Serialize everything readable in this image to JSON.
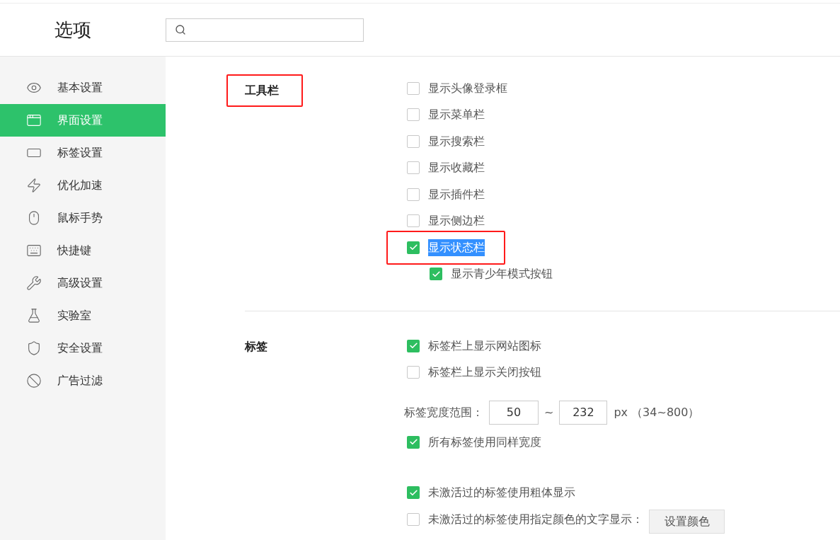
{
  "header": {
    "title": "选项"
  },
  "sidebar": {
    "items": [
      {
        "label": "基本设置",
        "selected": false
      },
      {
        "label": "界面设置",
        "selected": true
      },
      {
        "label": "标签设置",
        "selected": false
      },
      {
        "label": "优化加速",
        "selected": false
      },
      {
        "label": "鼠标手势",
        "selected": false
      },
      {
        "label": "快捷键",
        "selected": false
      },
      {
        "label": "高级设置",
        "selected": false
      },
      {
        "label": "实验室",
        "selected": false
      },
      {
        "label": "安全设置",
        "selected": false
      },
      {
        "label": "广告过滤",
        "selected": false
      }
    ]
  },
  "sections": [
    {
      "title": "工具栏",
      "annotated": true,
      "rows": [
        {
          "kind": "check",
          "label": "显示头像登录框",
          "checked": false,
          "annotated": false,
          "text_selected": false
        },
        {
          "kind": "check",
          "label": "显示菜单栏",
          "checked": false,
          "annotated": false,
          "text_selected": false
        },
        {
          "kind": "check",
          "label": "显示搜索栏",
          "checked": false,
          "annotated": false,
          "text_selected": false
        },
        {
          "kind": "check",
          "label": "显示收藏栏",
          "checked": false,
          "annotated": false,
          "text_selected": false
        },
        {
          "kind": "check",
          "label": "显示插件栏",
          "checked": false,
          "annotated": false,
          "text_selected": false
        },
        {
          "kind": "check",
          "label": "显示侧边栏",
          "checked": false,
          "annotated": false,
          "text_selected": false
        },
        {
          "kind": "check",
          "label": "显示状态栏",
          "checked": true,
          "annotated": true,
          "text_selected": true
        },
        {
          "kind": "subcheck",
          "label": "显示青少年模式按钮",
          "checked": true,
          "annotated": false,
          "text_selected": false
        }
      ]
    },
    {
      "title": "标签",
      "annotated": false,
      "rows": [
        {
          "kind": "check",
          "label": "标签栏上显示网站图标",
          "checked": true,
          "annotated": false,
          "text_selected": false
        },
        {
          "kind": "check",
          "label": "标签栏上显示关闭按钮",
          "checked": false,
          "annotated": false,
          "text_selected": false
        },
        {
          "kind": "range",
          "label": "标签宽度范围：",
          "min": "50",
          "separator": "~",
          "max": "232",
          "unit": "px （34~800）"
        },
        {
          "kind": "check",
          "label": "所有标签使用同样宽度",
          "checked": true,
          "annotated": false,
          "text_selected": false
        },
        {
          "kind": "check",
          "label": "未激活过的标签使用粗体显示",
          "checked": true,
          "annotated": false,
          "text_selected": false
        },
        {
          "kind": "check_button",
          "label": "未激活过的标签使用指定颜色的文字显示：",
          "checked": false,
          "button": "设置颜色"
        }
      ]
    }
  ]
}
